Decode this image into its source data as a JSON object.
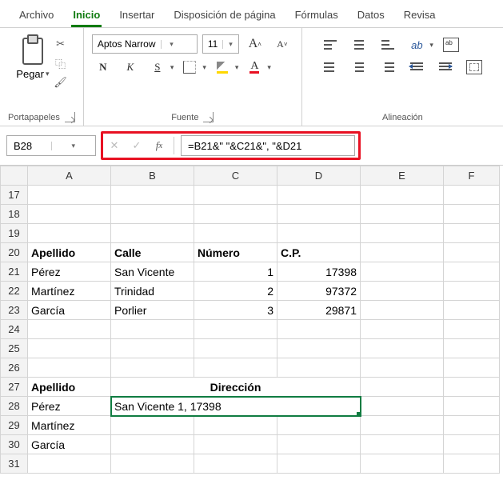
{
  "menu": {
    "tabs": [
      "Archivo",
      "Inicio",
      "Insertar",
      "Disposición de página",
      "Fórmulas",
      "Datos",
      "Revisa"
    ],
    "active_index": 1
  },
  "ribbon": {
    "clipboard": {
      "label": "Portapapeles",
      "paste": "Pegar"
    },
    "font": {
      "label": "Fuente",
      "name": "Aptos Narrow",
      "size": "11",
      "bold": "N",
      "italic": "K",
      "underline": "S",
      "font_color_glyph": "A"
    },
    "alignment": {
      "label": "Alineación"
    }
  },
  "name_box": "B28",
  "formula": "=B21&\" \"&C21&\", \"&D21",
  "columns": [
    "A",
    "B",
    "C",
    "D",
    "E",
    "F"
  ],
  "row_start": 17,
  "row_end": 31,
  "cells": {
    "20": {
      "A": "Apellido",
      "B": "Calle",
      "C": "Número",
      "D": "C.P."
    },
    "21": {
      "A": "Pérez",
      "B": "San Vicente",
      "C": "1",
      "D": "17398"
    },
    "22": {
      "A": "Martínez",
      "B": "Trinidad",
      "C": "2",
      "D": "97372"
    },
    "23": {
      "A": "García",
      "B": "Porlier",
      "C": "3",
      "D": "29871"
    },
    "27": {
      "A": "Apellido",
      "C": "Dirección"
    },
    "28": {
      "A": "Pérez",
      "B": "San Vicente 1, 17398"
    },
    "29": {
      "A": "Martínez"
    },
    "30": {
      "A": "García"
    }
  }
}
